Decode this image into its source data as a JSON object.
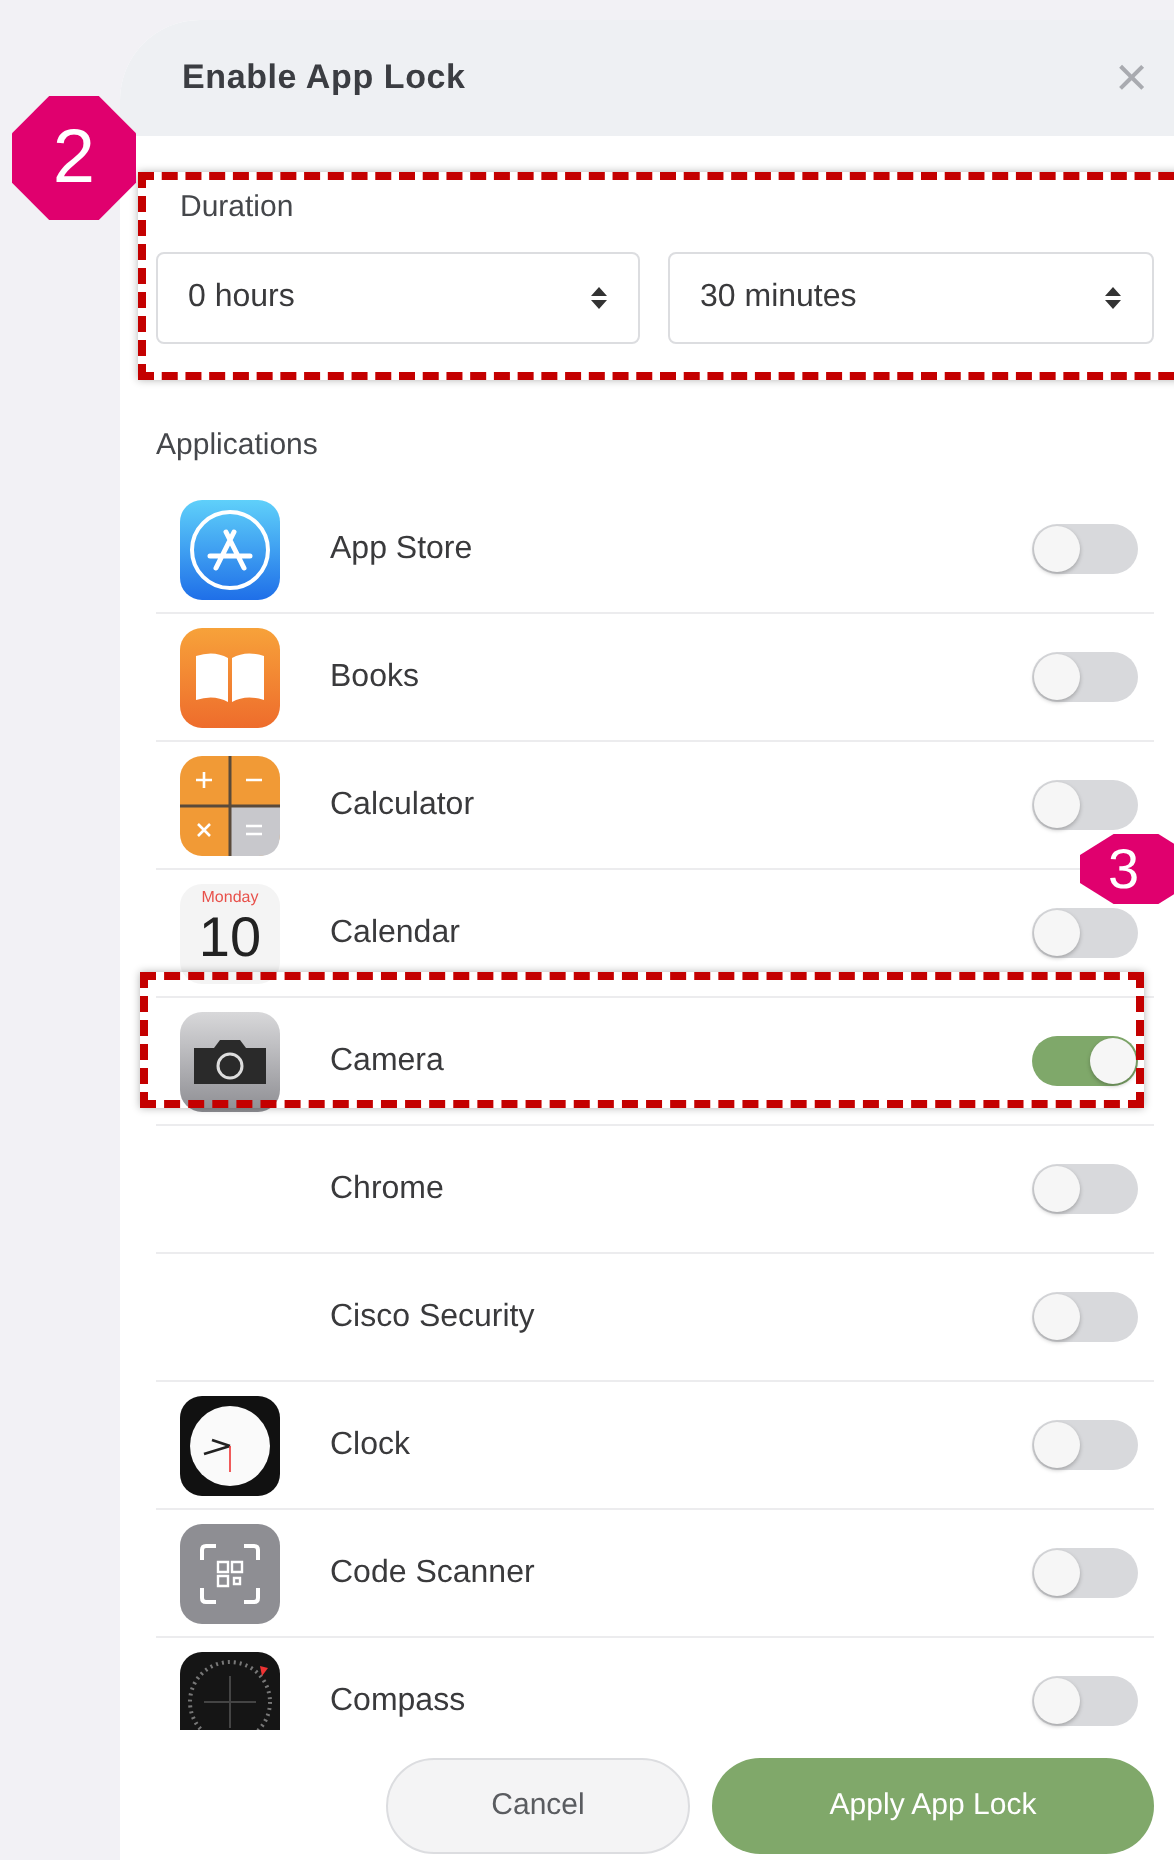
{
  "dialog": {
    "title": "Enable App Lock",
    "close": "×"
  },
  "duration": {
    "label": "Duration",
    "hours": "0 hours",
    "minutes": "30 minutes"
  },
  "applications": {
    "label": "Applications",
    "items": [
      {
        "name": "App Store",
        "kind": "appstore",
        "on": false
      },
      {
        "name": "Books",
        "kind": "books",
        "on": false
      },
      {
        "name": "Calculator",
        "kind": "calculator",
        "on": false
      },
      {
        "name": "Calendar",
        "kind": "calendar",
        "icon_day": "Monday",
        "icon_date": "10",
        "on": false
      },
      {
        "name": "Camera",
        "kind": "camera",
        "on": true
      },
      {
        "name": "Chrome",
        "kind": "none",
        "on": false
      },
      {
        "name": "Cisco Security",
        "kind": "none",
        "on": false
      },
      {
        "name": "Clock",
        "kind": "clock",
        "on": false
      },
      {
        "name": "Code Scanner",
        "kind": "scanner",
        "on": false
      },
      {
        "name": "Compass",
        "kind": "compass",
        "on": false
      }
    ]
  },
  "buttons": {
    "cancel": "Cancel",
    "apply": "Apply App Lock"
  },
  "callouts": [
    {
      "label": "2"
    },
    {
      "label": "3"
    }
  ]
}
